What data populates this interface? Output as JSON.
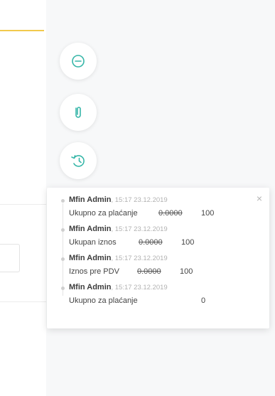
{
  "history": {
    "entries": [
      {
        "user": "Mfin Admin",
        "meta": ", 15:17 23.12.2019",
        "field": "Ukupno za plaćanje",
        "old_value": "0.0000",
        "new_value": "100"
      },
      {
        "user": "Mfin Admin",
        "meta": ", 15:17 23.12.2019",
        "field": "Ukupan iznos",
        "old_value": "0.0000",
        "new_value": "100"
      },
      {
        "user": "Mfin Admin",
        "meta": ", 15:17 23.12.2019",
        "field": "Iznos pre PDV",
        "old_value": "0.0000",
        "new_value": "100"
      },
      {
        "user": "Mfin Admin",
        "meta": ", 15:17 23.12.2019",
        "field": "Ukupno za plaćanje",
        "old_value": "",
        "new_value": "0"
      }
    ],
    "close_glyph": "×"
  },
  "side_buttons": [
    {
      "icon": "comment-icon"
    },
    {
      "icon": "paperclip-icon"
    },
    {
      "icon": "history-icon"
    }
  ],
  "colors": {
    "accent": "#f2c94c",
    "icon_teal": "#36b6a8"
  }
}
